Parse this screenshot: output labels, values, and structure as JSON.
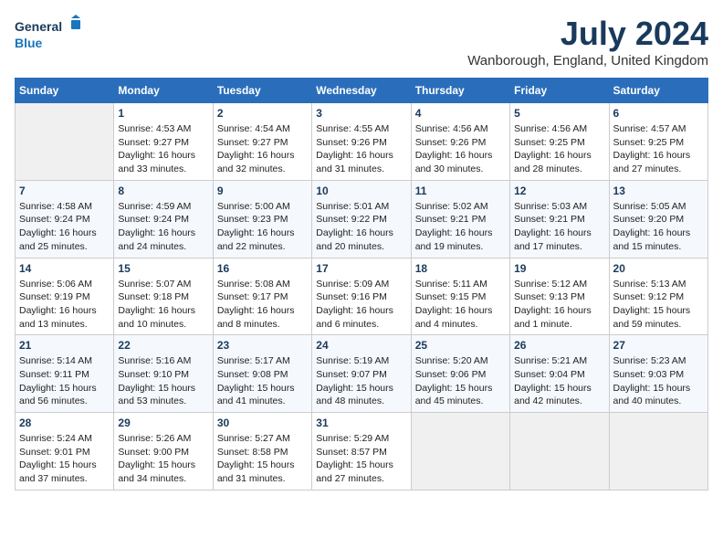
{
  "header": {
    "logo_line1": "General",
    "logo_line2": "Blue",
    "month_year": "July 2024",
    "location": "Wanborough, England, United Kingdom"
  },
  "days_of_week": [
    "Sunday",
    "Monday",
    "Tuesday",
    "Wednesday",
    "Thursday",
    "Friday",
    "Saturday"
  ],
  "weeks": [
    [
      {
        "day": "",
        "info": ""
      },
      {
        "day": "1",
        "info": "Sunrise: 4:53 AM\nSunset: 9:27 PM\nDaylight: 16 hours\nand 33 minutes."
      },
      {
        "day": "2",
        "info": "Sunrise: 4:54 AM\nSunset: 9:27 PM\nDaylight: 16 hours\nand 32 minutes."
      },
      {
        "day": "3",
        "info": "Sunrise: 4:55 AM\nSunset: 9:26 PM\nDaylight: 16 hours\nand 31 minutes."
      },
      {
        "day": "4",
        "info": "Sunrise: 4:56 AM\nSunset: 9:26 PM\nDaylight: 16 hours\nand 30 minutes."
      },
      {
        "day": "5",
        "info": "Sunrise: 4:56 AM\nSunset: 9:25 PM\nDaylight: 16 hours\nand 28 minutes."
      },
      {
        "day": "6",
        "info": "Sunrise: 4:57 AM\nSunset: 9:25 PM\nDaylight: 16 hours\nand 27 minutes."
      }
    ],
    [
      {
        "day": "7",
        "info": "Sunrise: 4:58 AM\nSunset: 9:24 PM\nDaylight: 16 hours\nand 25 minutes."
      },
      {
        "day": "8",
        "info": "Sunrise: 4:59 AM\nSunset: 9:24 PM\nDaylight: 16 hours\nand 24 minutes."
      },
      {
        "day": "9",
        "info": "Sunrise: 5:00 AM\nSunset: 9:23 PM\nDaylight: 16 hours\nand 22 minutes."
      },
      {
        "day": "10",
        "info": "Sunrise: 5:01 AM\nSunset: 9:22 PM\nDaylight: 16 hours\nand 20 minutes."
      },
      {
        "day": "11",
        "info": "Sunrise: 5:02 AM\nSunset: 9:21 PM\nDaylight: 16 hours\nand 19 minutes."
      },
      {
        "day": "12",
        "info": "Sunrise: 5:03 AM\nSunset: 9:21 PM\nDaylight: 16 hours\nand 17 minutes."
      },
      {
        "day": "13",
        "info": "Sunrise: 5:05 AM\nSunset: 9:20 PM\nDaylight: 16 hours\nand 15 minutes."
      }
    ],
    [
      {
        "day": "14",
        "info": "Sunrise: 5:06 AM\nSunset: 9:19 PM\nDaylight: 16 hours\nand 13 minutes."
      },
      {
        "day": "15",
        "info": "Sunrise: 5:07 AM\nSunset: 9:18 PM\nDaylight: 16 hours\nand 10 minutes."
      },
      {
        "day": "16",
        "info": "Sunrise: 5:08 AM\nSunset: 9:17 PM\nDaylight: 16 hours\nand 8 minutes."
      },
      {
        "day": "17",
        "info": "Sunrise: 5:09 AM\nSunset: 9:16 PM\nDaylight: 16 hours\nand 6 minutes."
      },
      {
        "day": "18",
        "info": "Sunrise: 5:11 AM\nSunset: 9:15 PM\nDaylight: 16 hours\nand 4 minutes."
      },
      {
        "day": "19",
        "info": "Sunrise: 5:12 AM\nSunset: 9:13 PM\nDaylight: 16 hours\nand 1 minute."
      },
      {
        "day": "20",
        "info": "Sunrise: 5:13 AM\nSunset: 9:12 PM\nDaylight: 15 hours\nand 59 minutes."
      }
    ],
    [
      {
        "day": "21",
        "info": "Sunrise: 5:14 AM\nSunset: 9:11 PM\nDaylight: 15 hours\nand 56 minutes."
      },
      {
        "day": "22",
        "info": "Sunrise: 5:16 AM\nSunset: 9:10 PM\nDaylight: 15 hours\nand 53 minutes."
      },
      {
        "day": "23",
        "info": "Sunrise: 5:17 AM\nSunset: 9:08 PM\nDaylight: 15 hours\nand 41 minutes."
      },
      {
        "day": "24",
        "info": "Sunrise: 5:19 AM\nSunset: 9:07 PM\nDaylight: 15 hours\nand 48 minutes."
      },
      {
        "day": "25",
        "info": "Sunrise: 5:20 AM\nSunset: 9:06 PM\nDaylight: 15 hours\nand 45 minutes."
      },
      {
        "day": "26",
        "info": "Sunrise: 5:21 AM\nSunset: 9:04 PM\nDaylight: 15 hours\nand 42 minutes."
      },
      {
        "day": "27",
        "info": "Sunrise: 5:23 AM\nSunset: 9:03 PM\nDaylight: 15 hours\nand 40 minutes."
      }
    ],
    [
      {
        "day": "28",
        "info": "Sunrise: 5:24 AM\nSunset: 9:01 PM\nDaylight: 15 hours\nand 37 minutes."
      },
      {
        "day": "29",
        "info": "Sunrise: 5:26 AM\nSunset: 9:00 PM\nDaylight: 15 hours\nand 34 minutes."
      },
      {
        "day": "30",
        "info": "Sunrise: 5:27 AM\nSunset: 8:58 PM\nDaylight: 15 hours\nand 31 minutes."
      },
      {
        "day": "31",
        "info": "Sunrise: 5:29 AM\nSunset: 8:57 PM\nDaylight: 15 hours\nand 27 minutes."
      },
      {
        "day": "",
        "info": ""
      },
      {
        "day": "",
        "info": ""
      },
      {
        "day": "",
        "info": ""
      }
    ]
  ]
}
